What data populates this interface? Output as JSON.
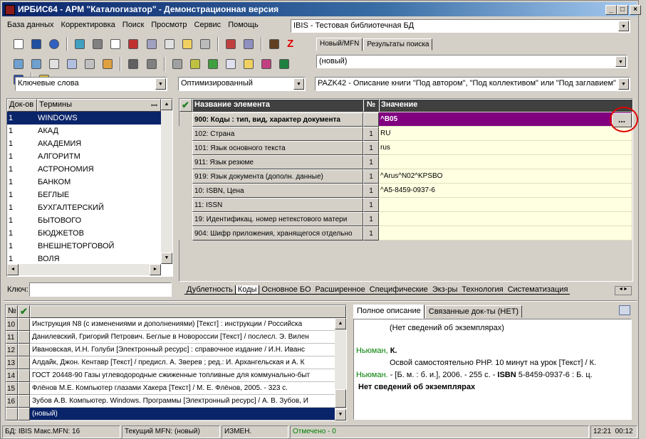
{
  "window": {
    "title": "ИРБИС64 - АРМ \"Каталогизатор\" - Демонстрационная версия",
    "min": "_",
    "max": "□",
    "close": "×"
  },
  "menu": [
    "База данных",
    "Корректировка",
    "Поиск",
    "Просмотр",
    "Сервис",
    "Помощь"
  ],
  "db_select": "IBIS - Тестовая библиотечная БД",
  "record_tabs": [
    "Новый/MFN",
    "Результаты поиска"
  ],
  "record_select": "(новый)",
  "search_mode": "Ключевые слова",
  "display_mode": "Оптимизированный",
  "worksheet": "PAZK42 - Описание книги \"Под автором\", \"Под коллективом\" или \"Под заглавием\"",
  "dictionary": {
    "headers": {
      "count": "Док-ов",
      "terms": "Термины"
    },
    "rows": [
      {
        "count": "1",
        "term": "WINDOWS"
      },
      {
        "count": "1",
        "term": "АКАД"
      },
      {
        "count": "1",
        "term": "АКАДЕМИЯ"
      },
      {
        "count": "1",
        "term": "АЛГОРИТМ"
      },
      {
        "count": "1",
        "term": "АСТРОНОМИЯ"
      },
      {
        "count": "1",
        "term": "БАНКОМ"
      },
      {
        "count": "1",
        "term": "БЕГЛЫЕ"
      },
      {
        "count": "1",
        "term": "БУХГАЛТЕРСКИЙ"
      },
      {
        "count": "1",
        "term": "БЫТОВОГО"
      },
      {
        "count": "1",
        "term": "БЮДЖЕТОВ"
      },
      {
        "count": "1",
        "term": "ВНЕШНЕТОРГОВОЙ"
      },
      {
        "count": "1",
        "term": "ВОЛЯ"
      }
    ],
    "key_label": "Ключ:",
    "key_value": ""
  },
  "editor": {
    "headers": {
      "name": "Название элемента",
      "num": "№",
      "value": "Значение"
    },
    "rows": [
      {
        "name": "900: Коды : тип, вид, характер документа",
        "num": "",
        "value": "^B05"
      },
      {
        "name": "102: Страна",
        "num": "1",
        "value": "RU"
      },
      {
        "name": "101: Язык основного текста",
        "num": "1",
        "value": "rus"
      },
      {
        "name": "911: Язык резюме",
        "num": "1",
        "value": ""
      },
      {
        "name": "919: Язык документа (дополн. данные)",
        "num": "1",
        "value": "^Arus^N02^KPSBO"
      },
      {
        "name": "10: ISBN, Цена",
        "num": "1",
        "value": "^A5-8459-0937-6"
      },
      {
        "name": "11: ISSN",
        "num": "1",
        "value": ""
      },
      {
        "name": "19: Идентификац. номер нетекстового матери",
        "num": "1",
        "value": ""
      },
      {
        "name": "904: Шифр приложения, хранящегося отдельно",
        "num": "1",
        "value": ""
      }
    ],
    "ellipsis": "...",
    "bottom_tabs": [
      "Дублетность",
      "Коды",
      "Основное БО",
      "Расширенное",
      "Специфические",
      "Экз-ры",
      "Технология",
      "Систематизация"
    ]
  },
  "results": {
    "headers": {
      "num": "№"
    },
    "rows": [
      {
        "n": "10",
        "text": "Инструкция N8   (с изменениями и дополнениями) [Текст] : инструкции / Российска"
      },
      {
        "n": "11",
        "text": "Данилевский, Григорий Петрович. Беглые в Новороссии [Текст] / послесл. Э. Вилен"
      },
      {
        "n": "12",
        "text": "Ивановская, И.Н. Голуби [Электронный ресурс] : справочное издание / И.Н. Иванс"
      },
      {
        "n": "13",
        "text": "Алдайк, Джон. Кентавр [Текст] / предисл. А. Зверев ; ред.: И. Архангельская и А. К"
      },
      {
        "n": "14",
        "text": "ГОСТ 20448-90 Газы углеводородные сжиженные топливные для коммунально-быт"
      },
      {
        "n": "15",
        "text": "Флёнов М.Е. Компьютер глазами Хакера [Текст] / М. Е. Флёнов, 2005. - 323 с."
      },
      {
        "n": "16",
        "text": "Зубов А.В. Компьютер. Windows. Программы [Электронный ресурс] / А. В. Зубов, И"
      },
      {
        "n": "",
        "text": "(новый)"
      }
    ]
  },
  "description": {
    "tabs": [
      "Полное описание",
      "Связанные док-ты (НЕТ)"
    ],
    "no_copies_top": "(Нет сведений об экземплярах)",
    "author_heading": "Ньюман,",
    "author_initial": "К.",
    "title_line": "Освой самостоятельно PHP. 10 минут на урок [Текст] / К.",
    "author2": "Ньюман.",
    "imprint_a": " - [Б. м. : б. и.], 2006. - 255 с. - ",
    "isbn_label": "ISBN",
    "imprint_b": " 5-8459-0937-6 : Б. ц.",
    "no_copies_bottom": "Нет сведений об экземплярах"
  },
  "statusbar": {
    "db": "БД: IBIS Макс.MFN: 16",
    "current": "Текущий MFN: (новый)",
    "changed": "ИЗМЕН.",
    "marked": "Отмечено - 0",
    "time": "12:21",
    "time2": "00:12"
  },
  "colors": {
    "title": "#0a246a",
    "selected": "#0a246a",
    "highlight_row": "#800080",
    "value_bg": "#ffffe1",
    "green": "#008000",
    "red_circle": "#e00000"
  }
}
